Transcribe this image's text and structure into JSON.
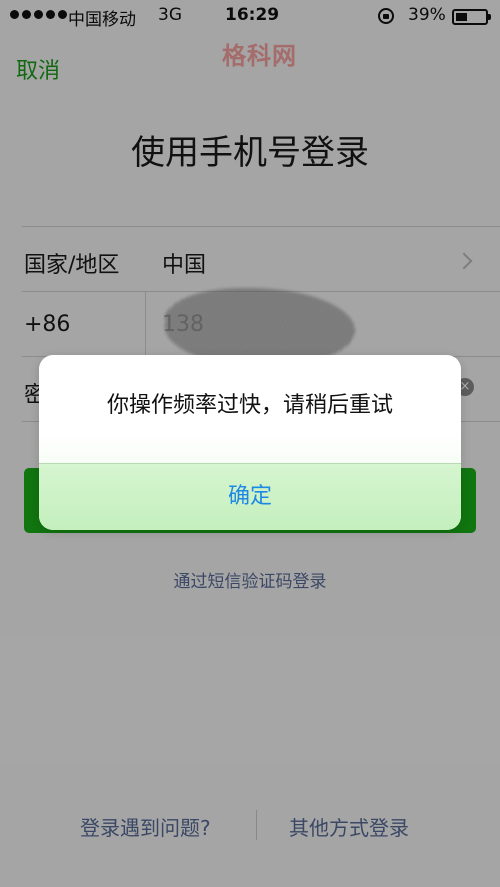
{
  "status_bar": {
    "carrier": "中国移动",
    "network": "3G",
    "time": "16:29",
    "battery_percent": "39%",
    "battery_level": 0.39
  },
  "nav": {
    "cancel_label": "取消",
    "watermark": "格科网"
  },
  "page": {
    "title": "使用手机号登录"
  },
  "form": {
    "region_label": "国家/地区",
    "region_value": "中国",
    "country_code": "+86",
    "phone_visible_prefix": "138",
    "password_label": "密",
    "clear_glyph": "×"
  },
  "sms_link": "通过短信验证码登录",
  "footer": {
    "trouble_label": "登录遇到问题?",
    "other_methods_label": "其他方式登录"
  },
  "dialog": {
    "message": "你操作频率过快，请稍后重试",
    "confirm_label": "确定"
  },
  "colors": {
    "accent_green": "#1aad19",
    "link_blue": "#576b95",
    "dialog_button_blue": "#1e88e5"
  }
}
